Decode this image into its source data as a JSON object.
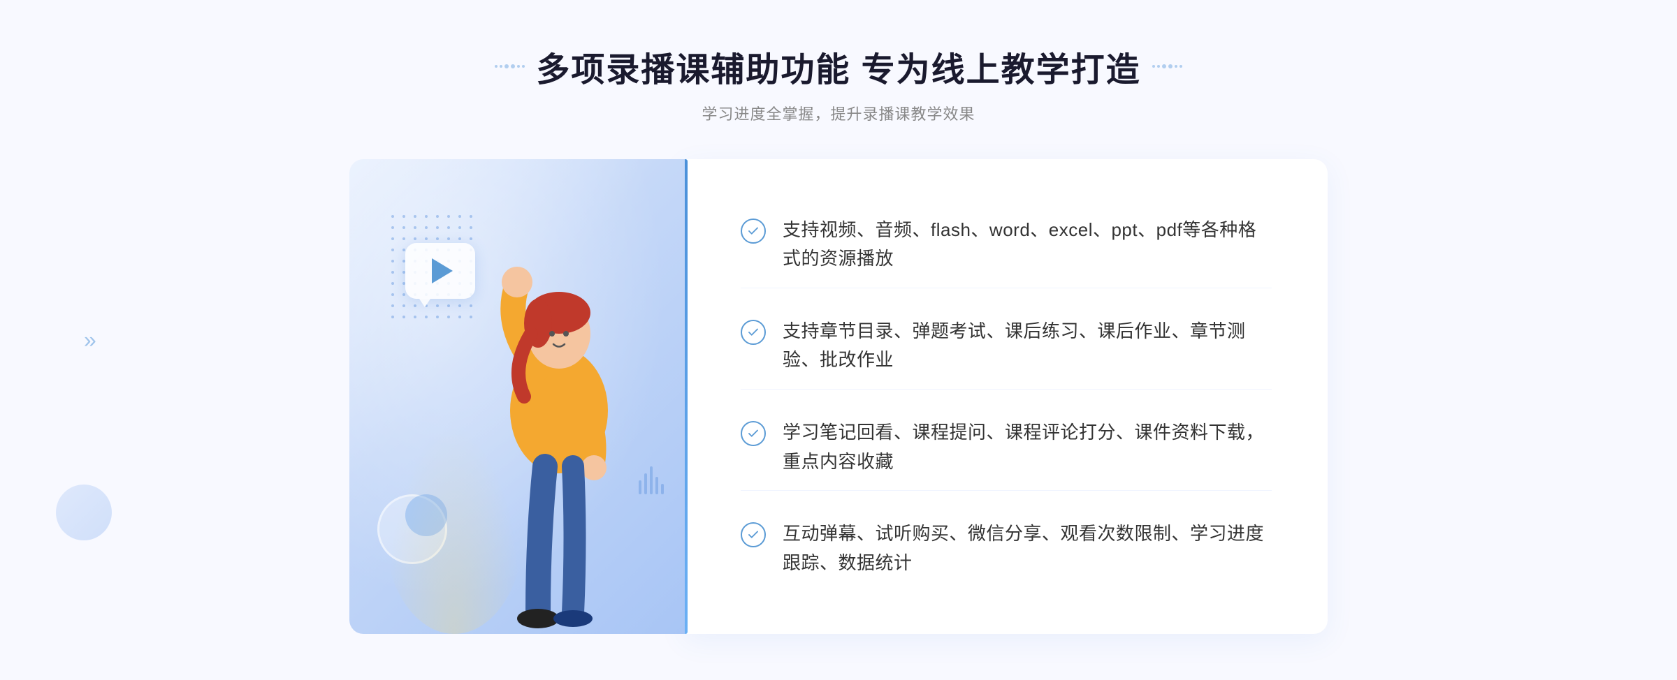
{
  "header": {
    "title": "多项录播课辅助功能 专为线上教学打造",
    "subtitle": "学习进度全掌握，提升录播课教学效果"
  },
  "features": [
    {
      "id": 1,
      "text": "支持视频、音频、flash、word、excel、ppt、pdf等各种格式的资源播放"
    },
    {
      "id": 2,
      "text": "支持章节目录、弹题考试、课后练习、课后作业、章节测验、批改作业"
    },
    {
      "id": 3,
      "text": "学习笔记回看、课程提问、课程评论打分、课件资料下载，重点内容收藏"
    },
    {
      "id": 4,
      "text": "互动弹幕、试听购买、微信分享、观看次数限制、学习进度跟踪、数据统计"
    }
  ],
  "colors": {
    "primary": "#4a90d9",
    "title": "#1a1a2e",
    "subtitle": "#888888",
    "text": "#333333",
    "check_border": "#5b9bd5",
    "check_color": "#5b9bd5"
  }
}
